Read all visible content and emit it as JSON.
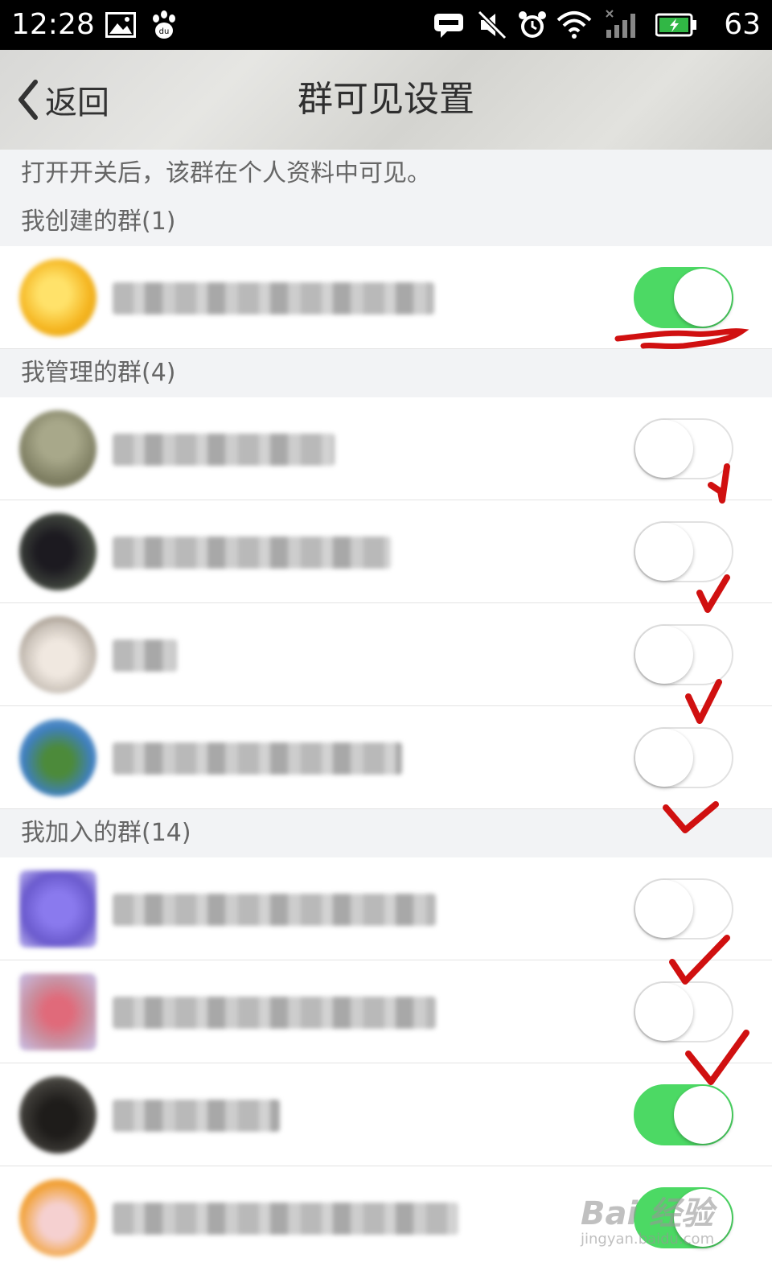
{
  "status_bar": {
    "time": "12:28",
    "battery_level": "63",
    "icons": [
      "image-icon",
      "baidu-paw-icon",
      "message-icon",
      "mute-icon",
      "alarm-icon",
      "wifi-icon",
      "signal-icon",
      "battery-icon"
    ]
  },
  "header": {
    "back_label": "返回",
    "title": "群可见设置"
  },
  "hint": "打开开关后，该群在个人资料中可见。",
  "sections": [
    {
      "title": "我创建的群(1)",
      "groups": [
        {
          "name_obscured": true,
          "toggle_on": true,
          "avatar_color": "#f5b520"
        }
      ]
    },
    {
      "title": "我管理的群(4)",
      "groups": [
        {
          "name_obscured": true,
          "toggle_on": false,
          "avatar_color": "#7a7a5e"
        },
        {
          "name_obscured": true,
          "toggle_on": false,
          "avatar_color": "#3b3f3a"
        },
        {
          "name_obscured": true,
          "toggle_on": false,
          "avatar_color": "#c9c1b8"
        },
        {
          "name_obscured": true,
          "toggle_on": false,
          "avatar_color": "#3f7fc0"
        }
      ]
    },
    {
      "title": "我加入的群(14)",
      "groups": [
        {
          "name_obscured": true,
          "toggle_on": false,
          "avatar_color": "#6a5acd"
        },
        {
          "name_obscured": true,
          "toggle_on": false,
          "avatar_color": "#c98f9f"
        },
        {
          "name_obscured": true,
          "toggle_on": true,
          "avatar_color": "#3c3a36"
        },
        {
          "name_obscured": true,
          "toggle_on": true,
          "avatar_color": "#f2a33a"
        }
      ]
    }
  ],
  "watermark": {
    "logo": "Bai 经验",
    "url": "jingyan.baidu.com"
  },
  "colors": {
    "toggle_on": "#4cd964",
    "annotation": "#d01010",
    "section_bg": "#f2f3f5"
  }
}
